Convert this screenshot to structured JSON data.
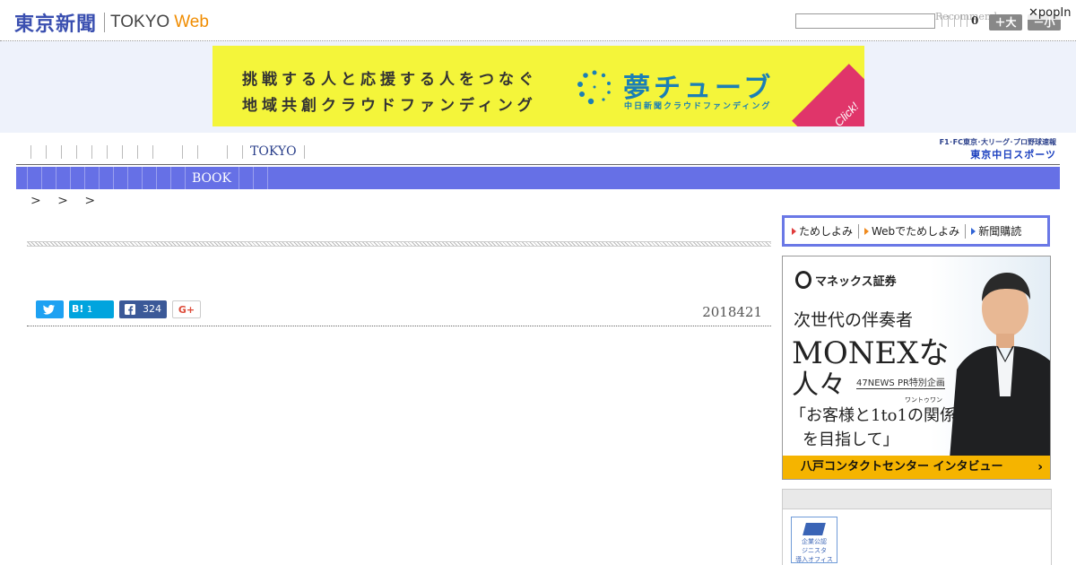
{
  "header": {
    "logo_jp": "東京新聞",
    "logo_en": "TOKYO",
    "logo_web": "Web",
    "search_placeholder": "",
    "recommend_label": "Recommend",
    "count": "0",
    "size_large": "＋大",
    "size_small": "－小",
    "popin": "popIn"
  },
  "banner": {
    "line1": "挑戦する人と応援する人をつなぐ",
    "line2": "地域共創クラウドファンディング",
    "brand": "夢チューブ",
    "sub": "中日新聞クラウドファンディング",
    "click": "Click!"
  },
  "nav_primary": {
    "tokyo_label": "TOKYO",
    "chunichi_top": "F1･FC東京･大リーグ･プロ野球速報",
    "chunichi_bottom": "東京中日スポーツ"
  },
  "nav_secondary": {
    "book_label": "BOOK"
  },
  "breadcrumb": "> > >",
  "article": {
    "date": "2018421"
  },
  "share": {
    "hatena_label": "B!",
    "hatena_count": "1",
    "facebook_count": "324",
    "gplus_label": "G+"
  },
  "sidebar": {
    "trial_links": [
      "ためしよみ",
      "Webでためしよみ",
      "新聞購読"
    ],
    "monex": {
      "logo": "マネックス証券",
      "line1": "次世代の伴奏者",
      "line2": "MONEXな",
      "line3": "人々",
      "tag": "47NEWS PR特別企画",
      "ruby": "ワントゥワン",
      "quote1": "「お客様と1to1の関係",
      "quote2": "を目指して」",
      "bar": "八戸コンタクトセンター インタビュー",
      "bar_arrow": "›"
    },
    "panel_thumb": "企業公認\nジニスタ\n導入オフィス\n募集"
  },
  "colors": {
    "nav_blue": "#6670e6",
    "logo_blue": "#3a4fb0",
    "web_orange": "#f08c00",
    "banner_yellow": "#f4f53a",
    "monex_yellow": "#f5b400"
  }
}
